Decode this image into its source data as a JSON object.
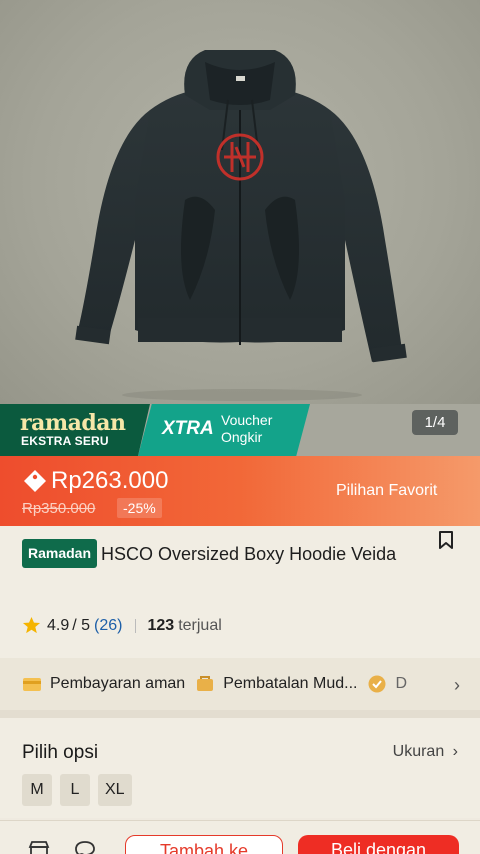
{
  "product_image": {
    "alt": "hoodie-product-photo"
  },
  "promo": {
    "ramadan_title": "ramadan",
    "ramadan_sub": "EKSTRA SERU",
    "xtra_label": "XTRA",
    "xtra_voucher": "Voucher Ongkir",
    "image_counter": "1/4"
  },
  "price": {
    "current": "Rp263.000",
    "original": "Rp350.000",
    "discount": "-25%",
    "label": "Pilihan Favorit"
  },
  "product": {
    "badge": "Ramadan",
    "title": "HSCO Oversized Boxy Hoodie Veida",
    "rating": "4.9",
    "rating_max": "/ 5",
    "rating_count": "(26)",
    "sold_count": "123",
    "sold_label": "terjual"
  },
  "guarantee": {
    "item1": "Pembayaran aman",
    "item2": "Pembatalan Mud...",
    "item3": "D"
  },
  "options": {
    "title": "Pilih opsi",
    "size_label": "Ukuran",
    "sizes": [
      "M",
      "L",
      "XL"
    ]
  },
  "actions": {
    "add_to_cart": "Tambah ke",
    "buy_now": "Beli dengan"
  },
  "colors": {
    "accent": "#ee4d2d",
    "ramadan_green": "#0b5a3e",
    "xtra_teal": "#13a38a",
    "link_blue": "#1d5fa8"
  }
}
